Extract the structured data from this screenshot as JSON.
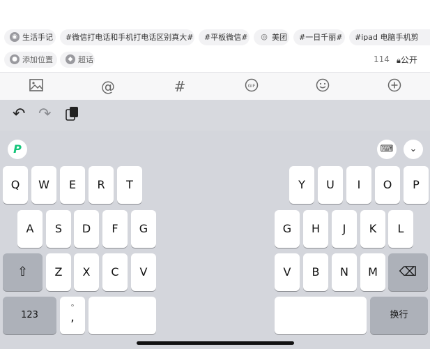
{
  "tags_row1": [
    "生活手记",
    "#微信打电话和手机打电话区别真大#",
    "#平板微信#",
    "美团",
    "#一日千丽#",
    "#ipad 电脑手机剪"
  ],
  "tags_row2": [
    "添加位置",
    "超话"
  ],
  "char_count": "114",
  "visibility": "公开",
  "toolbar_icons": [
    "image-icon",
    "mention-icon",
    "hashtag-icon",
    "gif-icon",
    "emoji-icon",
    "add-icon"
  ],
  "keyboard": {
    "row1_left": [
      "Q",
      "W",
      "E",
      "R",
      "T"
    ],
    "row1_right": [
      "Y",
      "U",
      "I",
      "O",
      "P"
    ],
    "row2_left": [
      "A",
      "S",
      "D",
      "F",
      "G"
    ],
    "row2_right": [
      "G",
      "H",
      "J",
      "K",
      "L"
    ],
    "row3_left": [
      "Z",
      "X",
      "C",
      "V"
    ],
    "row3_right": [
      "V",
      "B",
      "N",
      "M"
    ],
    "shift": "⇧",
    "delete": "⌫",
    "num": "123",
    "punct_top": "°",
    "punct_bottom": ",",
    "return": "换行",
    "logo": "P"
  },
  "colors": {
    "keyboard_bg": "#d4d6dc",
    "key_bg": "#ffffff",
    "dark_key": "#adb1b9",
    "logo_green": "#14c57a"
  }
}
